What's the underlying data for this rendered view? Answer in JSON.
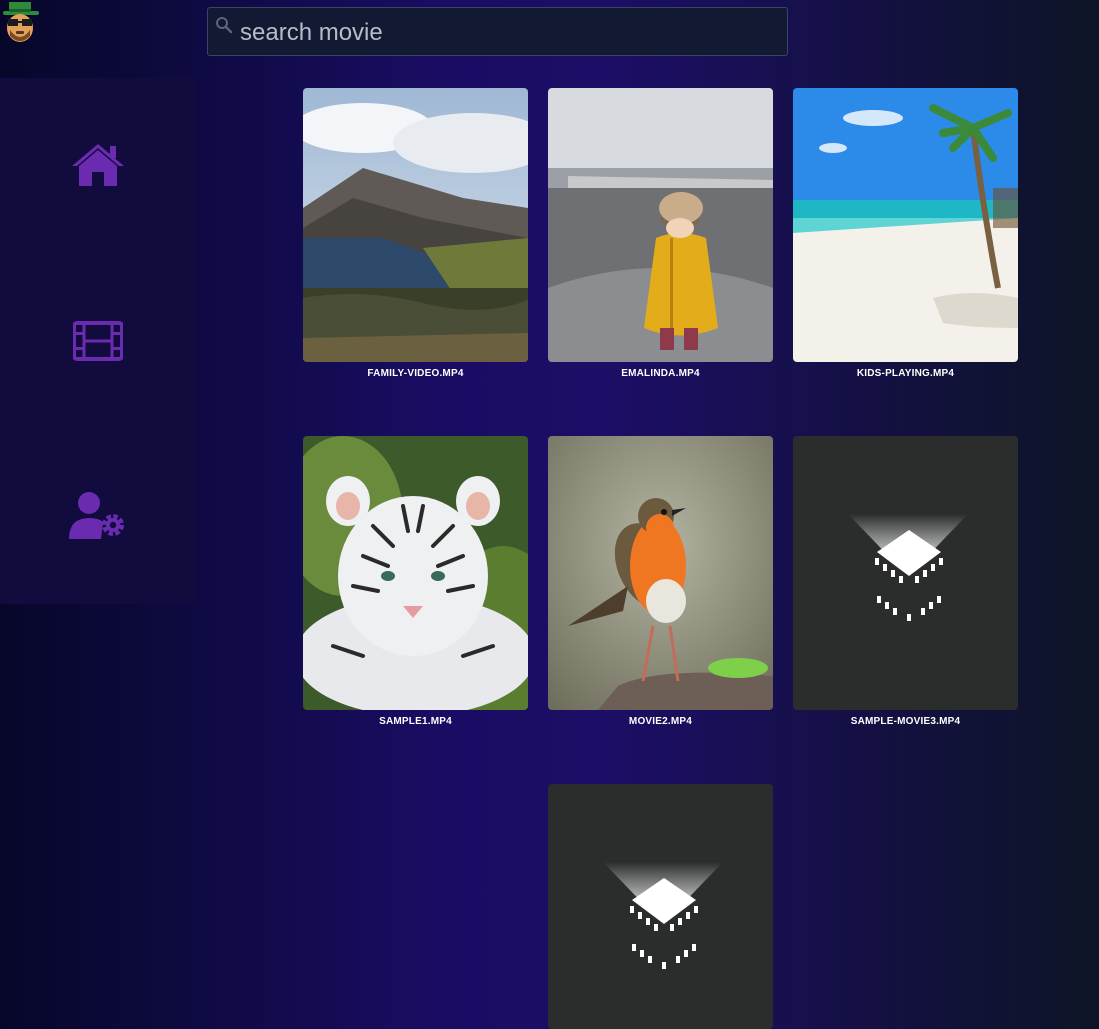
{
  "search": {
    "placeholder": "search movie",
    "value": ""
  },
  "logo": {
    "icon": "heisenberg-avatar-icon"
  },
  "sidebar": {
    "items": [
      {
        "name": "home",
        "icon": "home-icon"
      },
      {
        "name": "movies",
        "icon": "film-icon"
      },
      {
        "name": "user-settings",
        "icon": "user-gear-icon"
      }
    ],
    "accent_color": "#6a2bb0"
  },
  "movies": [
    {
      "title": "FAMILY-VIDEO.MP4",
      "thumbnail": "mountain-lake"
    },
    {
      "title": "EMALINDA.MP4",
      "thumbnail": "child-yellow-jacket"
    },
    {
      "title": "KIDS-PLAYING.MP4",
      "thumbnail": "tropical-beach"
    },
    {
      "title": "SAMPLE1.MP4",
      "thumbnail": "white-tiger-cub"
    },
    {
      "title": "MOVIE2.MP4",
      "thumbnail": "robin-bird"
    },
    {
      "title": "SAMPLE-MOVIE3.MP4",
      "thumbnail": "video-placeholder-icon"
    },
    {
      "title": "",
      "thumbnail": "video-placeholder-icon"
    }
  ]
}
